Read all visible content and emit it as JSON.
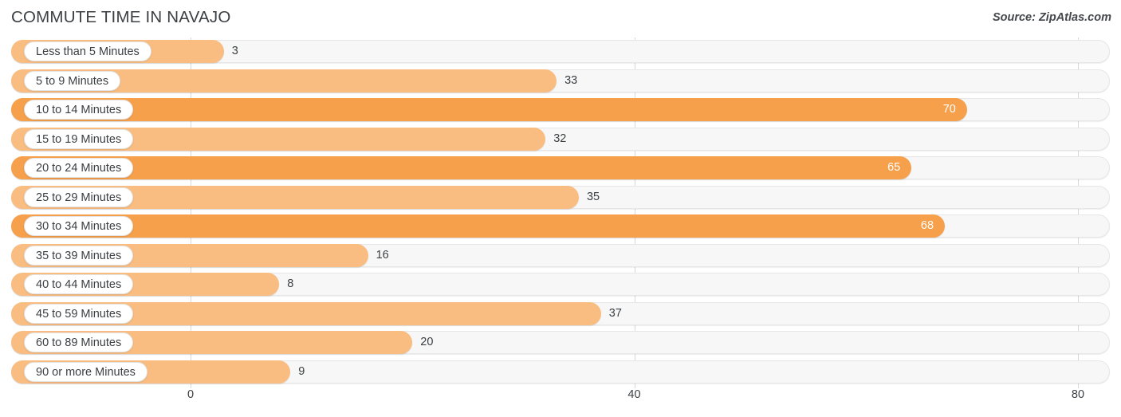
{
  "header": {
    "title": "COMMUTE TIME IN NAVAJO",
    "source": "Source: ZipAtlas.com"
  },
  "colors": {
    "bar_light": "#fabd81",
    "bar_dark": "#f6a04b",
    "track": "#f7f7f7",
    "text": "#3c4043",
    "gridline": "#d8d8d8"
  },
  "chart_data": {
    "type": "bar",
    "orientation": "horizontal",
    "title": "COMMUTE TIME IN NAVAJO",
    "xlabel": "",
    "ylabel": "",
    "xlim": [
      0,
      80
    ],
    "grid": true,
    "legend": "none",
    "xticks": [
      {
        "label": "0",
        "value": 0
      },
      {
        "label": "40",
        "value": 40
      },
      {
        "label": "80",
        "value": 80
      }
    ],
    "categories": [
      "Less than 5 Minutes",
      "5 to 9 Minutes",
      "10 to 14 Minutes",
      "15 to 19 Minutes",
      "20 to 24 Minutes",
      "25 to 29 Minutes",
      "30 to 34 Minutes",
      "35 to 39 Minutes",
      "40 to 44 Minutes",
      "45 to 59 Minutes",
      "60 to 89 Minutes",
      "90 or more Minutes"
    ],
    "values": [
      3,
      33,
      70,
      32,
      65,
      35,
      68,
      16,
      8,
      37,
      20,
      9
    ],
    "rows": [
      {
        "label": "Less than 5 Minutes",
        "value": 3,
        "value_text": "3",
        "shade": "light",
        "label_inside": true
      },
      {
        "label": "5 to 9 Minutes",
        "value": 33,
        "value_text": "33",
        "shade": "light",
        "label_inside": true
      },
      {
        "label": "10 to 14 Minutes",
        "value": 70,
        "value_text": "70",
        "shade": "dark",
        "label_inside": true
      },
      {
        "label": "15 to 19 Minutes",
        "value": 32,
        "value_text": "32",
        "shade": "light",
        "label_inside": true
      },
      {
        "label": "20 to 24 Minutes",
        "value": 65,
        "value_text": "65",
        "shade": "dark",
        "label_inside": true
      },
      {
        "label": "25 to 29 Minutes",
        "value": 35,
        "value_text": "35",
        "shade": "light",
        "label_inside": true
      },
      {
        "label": "30 to 34 Minutes",
        "value": 68,
        "value_text": "68",
        "shade": "dark",
        "label_inside": true
      },
      {
        "label": "35 to 39 Minutes",
        "value": 16,
        "value_text": "16",
        "shade": "light",
        "label_inside": true
      },
      {
        "label": "40 to 44 Minutes",
        "value": 8,
        "value_text": "8",
        "shade": "light",
        "label_inside": true
      },
      {
        "label": "45 to 59 Minutes",
        "value": 37,
        "value_text": "37",
        "shade": "light",
        "label_inside": true
      },
      {
        "label": "60 to 89 Minutes",
        "value": 20,
        "value_text": "20",
        "shade": "light",
        "label_inside": true
      },
      {
        "label": "90 or more Minutes",
        "value": 9,
        "value_text": "9",
        "shade": "light",
        "label_inside": true
      }
    ]
  }
}
